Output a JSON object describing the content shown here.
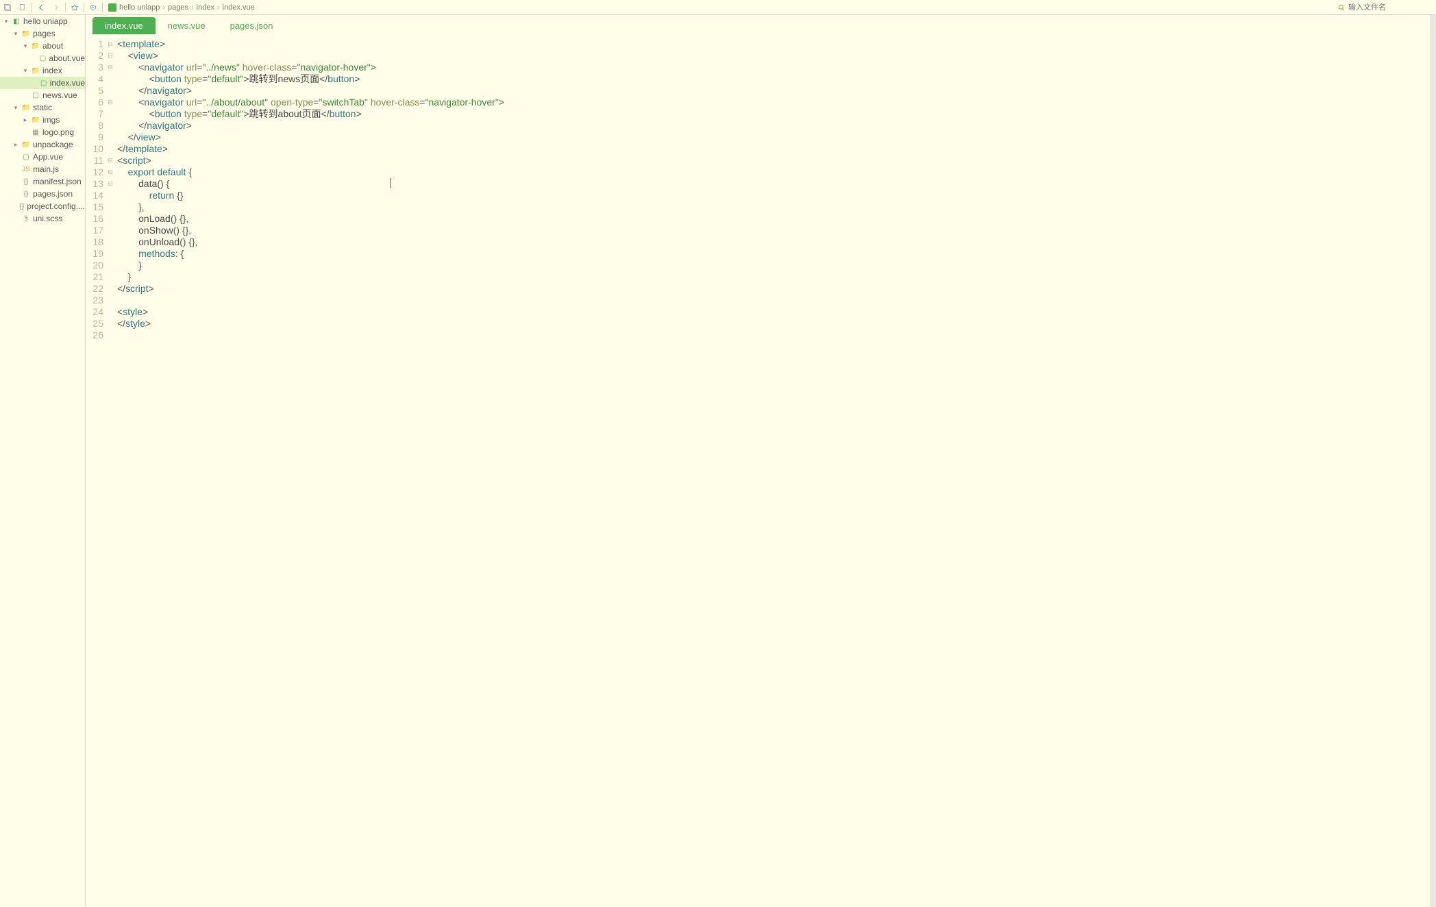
{
  "toolbar": {
    "search_placeholder": "输入文件名"
  },
  "breadcrumb": [
    "hello uniapp",
    "pages",
    "index",
    "index.vue"
  ],
  "tabs": [
    {
      "label": "index.vue",
      "active": true
    },
    {
      "label": "news.vue",
      "active": false
    },
    {
      "label": "pages.json",
      "active": false
    }
  ],
  "tree": [
    {
      "depth": 0,
      "arrow": "▾",
      "icon": "proj",
      "label": "hello uniapp"
    },
    {
      "depth": 1,
      "arrow": "▾",
      "icon": "folder",
      "label": "pages"
    },
    {
      "depth": 2,
      "arrow": "▾",
      "icon": "folder",
      "label": "about"
    },
    {
      "depth": 3,
      "arrow": "",
      "icon": "vue",
      "label": "about.vue"
    },
    {
      "depth": 2,
      "arrow": "▾",
      "icon": "folder",
      "label": "index"
    },
    {
      "depth": 3,
      "arrow": "",
      "icon": "vue",
      "label": "index.vue",
      "sel": true
    },
    {
      "depth": 2,
      "arrow": "",
      "icon": "vue",
      "label": "news.vue"
    },
    {
      "depth": 1,
      "arrow": "▾",
      "icon": "folder",
      "label": "static"
    },
    {
      "depth": 2,
      "arrow": "▸",
      "icon": "folder",
      "label": "imgs"
    },
    {
      "depth": 2,
      "arrow": "",
      "icon": "png",
      "label": "logo.png"
    },
    {
      "depth": 1,
      "arrow": "▸",
      "icon": "folder",
      "label": "unpackage"
    },
    {
      "depth": 1,
      "arrow": "",
      "icon": "vue",
      "label": "App.vue"
    },
    {
      "depth": 1,
      "arrow": "",
      "icon": "js",
      "label": "main.js"
    },
    {
      "depth": 1,
      "arrow": "",
      "icon": "json",
      "label": "manifest.json"
    },
    {
      "depth": 1,
      "arrow": "",
      "icon": "json",
      "label": "pages.json"
    },
    {
      "depth": 1,
      "arrow": "",
      "icon": "json",
      "label": "project.config...."
    },
    {
      "depth": 1,
      "arrow": "",
      "icon": "scss",
      "label": "uni.scss"
    }
  ],
  "code": {
    "line_count": 26,
    "fold_markers": {
      "1": "⊟",
      "2": "⊟",
      "3": "⊟",
      "6": "⊟",
      "11": "⊟",
      "12": "⊟",
      "13": "⊟"
    },
    "lines": [
      {
        "n": 1,
        "html": "<span class='c-punc'>&lt;</span><span class='c-tag'>template</span><span class='c-punc'>&gt;</span>"
      },
      {
        "n": 2,
        "html": "    <span class='c-punc'>&lt;</span><span class='c-tag'>view</span><span class='c-punc'>&gt;</span>"
      },
      {
        "n": 3,
        "html": "        <span class='c-punc'>&lt;</span><span class='c-tag'>navigator</span> <span class='c-attr'>url</span><span class='c-punc'>=</span><span class='c-str'>\"../news\"</span> <span class='c-attr'>hover-class</span><span class='c-punc'>=</span><span class='c-str'>\"navigator-hover\"</span><span class='c-punc'>&gt;</span>"
      },
      {
        "n": 4,
        "html": "            <span class='c-punc'>&lt;</span><span class='c-tag'>button</span> <span class='c-attr'>type</span><span class='c-punc'>=</span><span class='c-str'>\"default\"</span><span class='c-punc'>&gt;</span><span class='c-txt'>跳转到news页面</span><span class='c-punc'>&lt;/</span><span class='c-tag'>button</span><span class='c-punc'>&gt;</span>"
      },
      {
        "n": 5,
        "html": "        <span class='c-punc'>&lt;/</span><span class='c-tag'>navigator</span><span class='c-punc'>&gt;</span>"
      },
      {
        "n": 6,
        "html": "        <span class='c-punc'>&lt;</span><span class='c-tag'>navigator</span> <span class='c-attr'>url</span><span class='c-punc'>=</span><span class='c-str'>\"../about/about\"</span> <span class='c-attr'>open-type</span><span class='c-punc'>=</span><span class='c-str'>\"switchTab\"</span> <span class='c-attr'>hover-class</span><span class='c-punc'>=</span><span class='c-str'>\"navigator-hover\"</span><span class='c-punc'>&gt;</span>"
      },
      {
        "n": 7,
        "html": "            <span class='c-punc'>&lt;</span><span class='c-tag'>button</span> <span class='c-attr'>type</span><span class='c-punc'>=</span><span class='c-str'>\"default\"</span><span class='c-punc'>&gt;</span><span class='c-txt'>跳转到about页面</span><span class='c-punc'>&lt;/</span><span class='c-tag'>button</span><span class='c-punc'>&gt;</span>"
      },
      {
        "n": 8,
        "html": "        <span class='c-punc'>&lt;/</span><span class='c-tag'>navigator</span><span class='c-punc'>&gt;</span>"
      },
      {
        "n": 9,
        "html": "    <span class='c-punc'>&lt;/</span><span class='c-tag'>view</span><span class='c-punc'>&gt;</span>"
      },
      {
        "n": 10,
        "html": "<span class='c-punc'>&lt;/</span><span class='c-tag'>template</span><span class='c-punc'>&gt;</span>"
      },
      {
        "n": 11,
        "html": "<span class='c-punc'>&lt;</span><span class='c-tag'>script</span><span class='c-punc'>&gt;</span>"
      },
      {
        "n": 12,
        "html": "    <span class='c-kw'>export</span> <span class='c-kw'>default</span> <span class='c-punc'>{</span>"
      },
      {
        "n": 13,
        "html": "        <span class='c-txt'>data</span><span class='c-punc'>() {</span>"
      },
      {
        "n": 14,
        "html": "            <span class='c-kw'>return</span> <span class='c-punc'>{}</span>"
      },
      {
        "n": 15,
        "html": "        <span class='c-punc'>},</span>"
      },
      {
        "n": 16,
        "html": "        <span class='c-txt'>onLoad</span><span class='c-punc'>() {},</span>"
      },
      {
        "n": 17,
        "html": "        <span class='c-txt'>onShow</span><span class='c-punc'>() {},</span>"
      },
      {
        "n": 18,
        "html": "        <span class='c-txt'>onUnload</span><span class='c-punc'>() {},</span>"
      },
      {
        "n": 19,
        "html": "        <span class='c-kw'>methods</span><span class='c-punc'>: {</span>"
      },
      {
        "n": 20,
        "html": "        <span class='c-punc'>}</span>"
      },
      {
        "n": 21,
        "html": "    <span class='c-punc'>}</span>"
      },
      {
        "n": 22,
        "html": "<span class='c-punc'>&lt;/</span><span class='c-tag'>script</span><span class='c-punc'>&gt;</span>"
      },
      {
        "n": 23,
        "html": ""
      },
      {
        "n": 24,
        "html": "<span class='c-punc'>&lt;</span><span class='c-tag'>style</span><span class='c-punc'>&gt;</span>"
      },
      {
        "n": 25,
        "html": "<span class='c-punc'>&lt;/</span><span class='c-tag'>style</span><span class='c-punc'>&gt;</span>"
      },
      {
        "n": 26,
        "html": ""
      }
    ],
    "cursor": {
      "line": 13,
      "col": 56
    }
  }
}
